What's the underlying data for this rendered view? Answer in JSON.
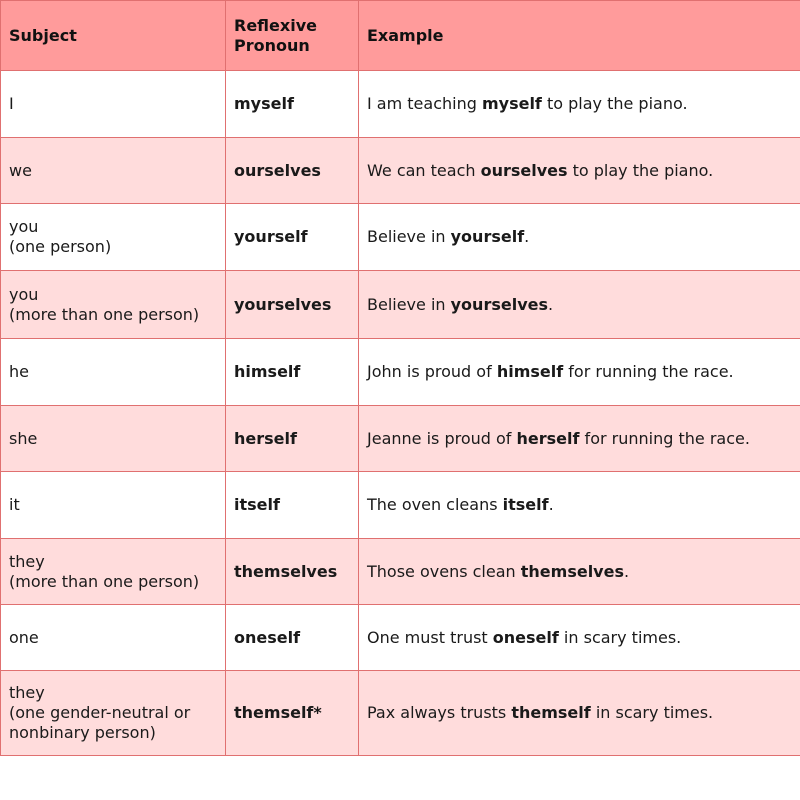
{
  "headers": [
    "Subject",
    "Reflexive Pronoun",
    "Example"
  ],
  "rows": [
    {
      "subject": "I",
      "subject_note": "",
      "pronoun": "myself",
      "example": {
        "before": "I am teaching ",
        "bold": "myself",
        "after": " to play the piano."
      }
    },
    {
      "subject": "we",
      "subject_note": "",
      "pronoun": "ourselves",
      "example": {
        "before": "We can teach ",
        "bold": "ourselves",
        "after": " to play the piano."
      }
    },
    {
      "subject": "you",
      "subject_note": "(one person)",
      "pronoun": "yourself",
      "example": {
        "before": "Believe in ",
        "bold": "yourself",
        "after": "."
      }
    },
    {
      "subject": "you",
      "subject_note": "(more than one person)",
      "pronoun": "yourselves",
      "example": {
        "before": "Believe in ",
        "bold": "yourselves",
        "after": "."
      }
    },
    {
      "subject": "he",
      "subject_note": "",
      "pronoun": "himself",
      "example": {
        "before": "John is proud of ",
        "bold": "himself",
        "after": " for running the race."
      }
    },
    {
      "subject": "she",
      "subject_note": "",
      "pronoun": "herself",
      "example": {
        "before": "Jeanne is proud of ",
        "bold": "herself",
        "after": " for running the race."
      }
    },
    {
      "subject": "it",
      "subject_note": "",
      "pronoun": "itself",
      "example": {
        "before": "The oven cleans ",
        "bold": "itself",
        "after": "."
      }
    },
    {
      "subject": "they",
      "subject_note": "(more than one person)",
      "pronoun": "themselves",
      "example": {
        "before": "Those ovens clean ",
        "bold": "themselves",
        "after": "."
      }
    },
    {
      "subject": "one",
      "subject_note": "",
      "pronoun": "oneself",
      "example": {
        "before": "One must trust ",
        "bold": "oneself",
        "after": " in scary times."
      }
    },
    {
      "subject": "they",
      "subject_note": "(one gender-neutral or nonbinary person)",
      "pronoun": "themself*",
      "example": {
        "before": "Pax always trusts ",
        "bold": "themself",
        "after": " in scary times."
      }
    }
  ],
  "colors": {
    "header": "#ff9b9b",
    "row_alt": "#ffdcdc",
    "row": "#ffffff",
    "border": "#e07070"
  }
}
